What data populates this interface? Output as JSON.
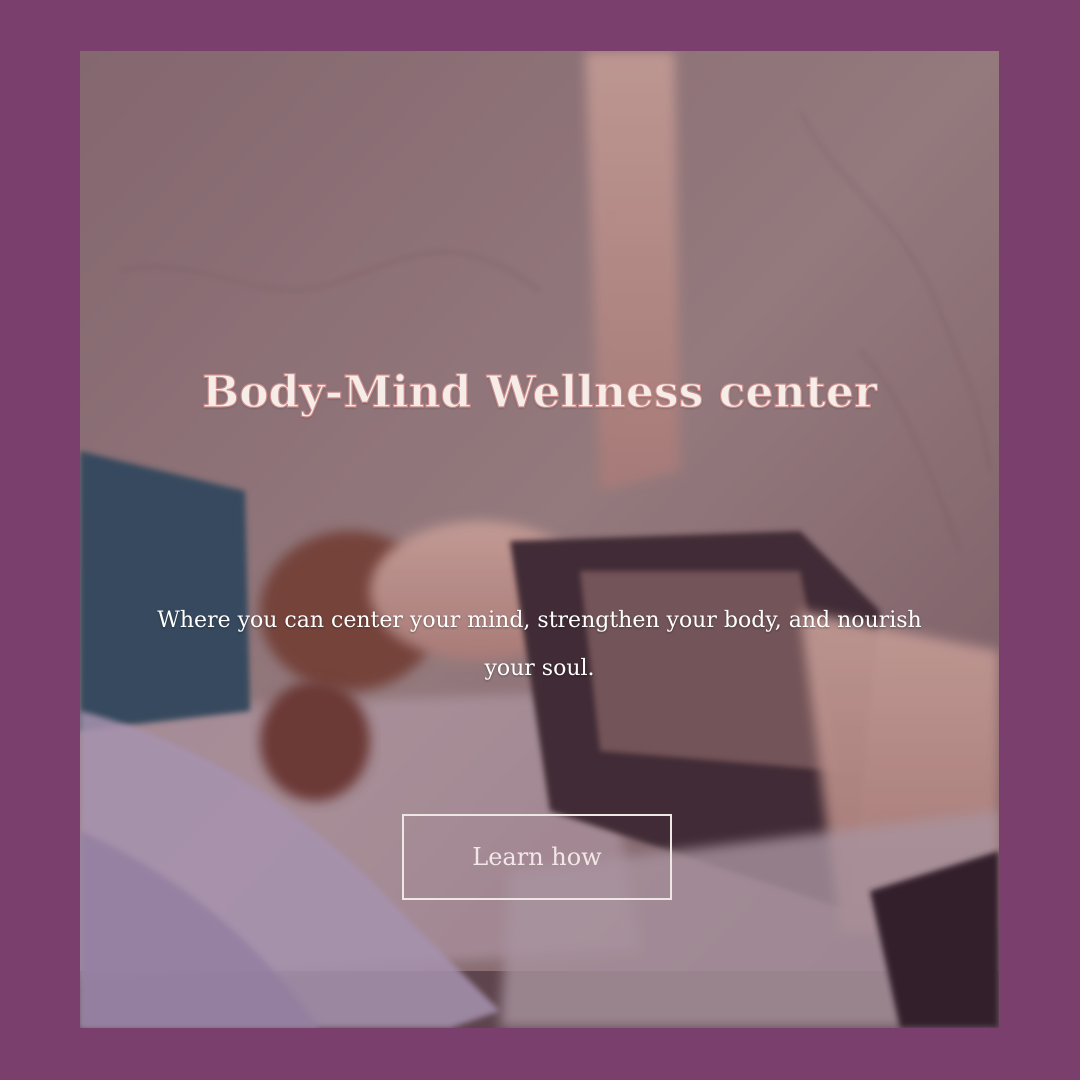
{
  "page": {
    "background_color": "#7b3f6e"
  },
  "hero": {
    "title": "Body-Mind Wellness center",
    "subtitle": "Where you can center your mind, strengthen your body, and nourish your soul.",
    "cta_label": "Learn how",
    "image_icon": "yoga-photo"
  }
}
